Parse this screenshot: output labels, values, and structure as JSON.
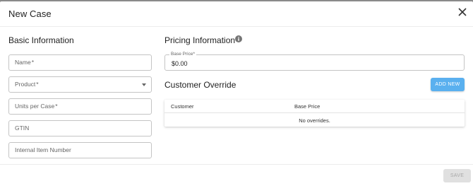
{
  "dialog": {
    "title": "New Case",
    "close_icon": "close-icon"
  },
  "basic_info": {
    "title": "Basic Information",
    "fields": [
      {
        "label": "Name",
        "required": "*"
      },
      {
        "label": "Product",
        "required": "*",
        "type": "select"
      },
      {
        "label": "Units per Case",
        "required": "*"
      },
      {
        "label": "GTIN",
        "required": ""
      },
      {
        "label": "Internal Item Number",
        "required": ""
      }
    ]
  },
  "pricing": {
    "title": "Pricing Information",
    "info_icon": "info-icon",
    "base_price_label": "Base Price",
    "base_price_required": "*",
    "base_price_value": "$0.00"
  },
  "override": {
    "title": "Customer Override",
    "add_label": "ADD NEW",
    "columns": [
      "Customer",
      "Base Price"
    ],
    "empty_text": "No overrides."
  },
  "footer": {
    "save_label": "SAVE"
  },
  "colors": {
    "primary": "#5ab0ef",
    "disabled_bg": "#e0e0e0",
    "disabled_text": "#a8a8a8"
  }
}
